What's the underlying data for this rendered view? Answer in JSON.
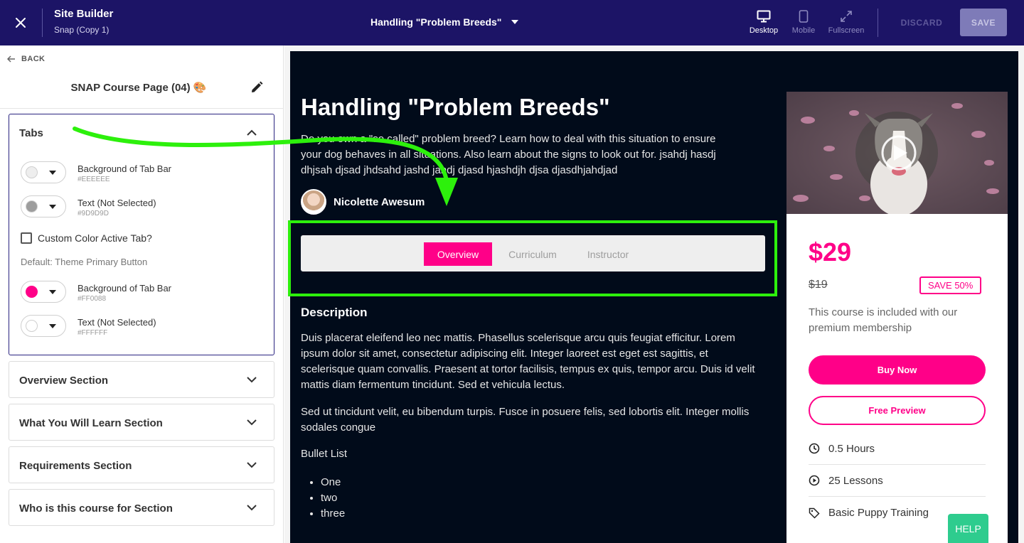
{
  "topbar": {
    "app_title": "Site Builder",
    "app_subtitle": "Snap (Copy 1)",
    "page_name": "Handling \"Problem Breeds\"",
    "views": {
      "desktop": "Desktop",
      "mobile": "Mobile",
      "fullscreen": "Fullscreen"
    },
    "active_view": "Desktop",
    "discard_label": "DISCARD",
    "save_label": "SAVE",
    "bar_color": "#1c1466"
  },
  "sidebar": {
    "back_label": "BACK",
    "title": "SNAP Course Page (04) 🎨",
    "tabs_section": {
      "title": "Tabs",
      "expanded": true,
      "colors": [
        {
          "label": "Background of Tab Bar",
          "hex": "#EEEEEE",
          "swatch": "#EEEEEE"
        },
        {
          "label": "Text (Not Selected)",
          "hex": "#9D9D9D",
          "swatch": "#9D9D9D"
        },
        {
          "label": "Background of Tab Bar",
          "hex": "#FF0088",
          "swatch": "#FF0088"
        },
        {
          "label": "Text (Not Selected)",
          "hex": "#FFFFFF",
          "swatch": "#FFFFFF"
        }
      ],
      "custom_active_label": "Custom Color Active Tab?",
      "custom_active_checked": false,
      "default_note": "Default: Theme Primary Button"
    },
    "sections": [
      {
        "title": "Overview Section"
      },
      {
        "title": "What You Will Learn Section"
      },
      {
        "title": "Requirements Section"
      },
      {
        "title": "Who is this course for Section"
      }
    ]
  },
  "preview": {
    "course_title": "Handling \"Problem Breeds\"",
    "course_description": "Do you own a \"so called\" problem breed? Learn how to deal with this situation to ensure your dog behaves in all situations. Also learn about the signs to look out for. jsahdj hasdj dhjsah djsad jhdsahd jashd jahdj djasd hjashdjh djsa djasdhjahdjad",
    "author_name": "Nicolette Awesum",
    "tabs": [
      "Overview",
      "Curriculum",
      "Instructor"
    ],
    "active_tab": "Overview",
    "description_heading": "Description",
    "paragraphs": [
      "Duis placerat eleifend leo nec mattis. Phasellus scelerisque arcu quis feugiat efficitur. Lorem ipsum dolor sit amet, consectetur adipiscing elit. Integer laoreet est eget est sagittis, et scelerisque quam convallis. Praesent at tortor facilisis, tempus ex quis, tempor arcu. Duis id velit mattis diam fermentum tincidunt. Sed et vehicula lectus.",
      "Sed ut tincidunt velit, eu bibendum turpis. Fusce in posuere felis, sed lobortis elit. Integer mollis sodales congue"
    ],
    "bullet_list_title": "Bullet List",
    "bullets": [
      "One",
      "two",
      "three"
    ],
    "card": {
      "price": "$29",
      "old_price": "$19",
      "save_badge": "SAVE 50%",
      "membership_note": "This course is included with our premium membership",
      "buy_label": "Buy Now",
      "preview_label": "Free Preview",
      "meta": [
        {
          "icon": "clock-icon",
          "text": "0.5 Hours"
        },
        {
          "icon": "play-circle-icon",
          "text": "25 Lessons"
        },
        {
          "icon": "tag-icon",
          "text": "Basic Puppy Training"
        }
      ]
    },
    "accent_color": "#FF0088",
    "background_color": "#010B1A"
  },
  "help_label": "HELP",
  "annotation": {
    "arrow_color": "#2DF00C",
    "highlight_color": "#2DF00C"
  }
}
